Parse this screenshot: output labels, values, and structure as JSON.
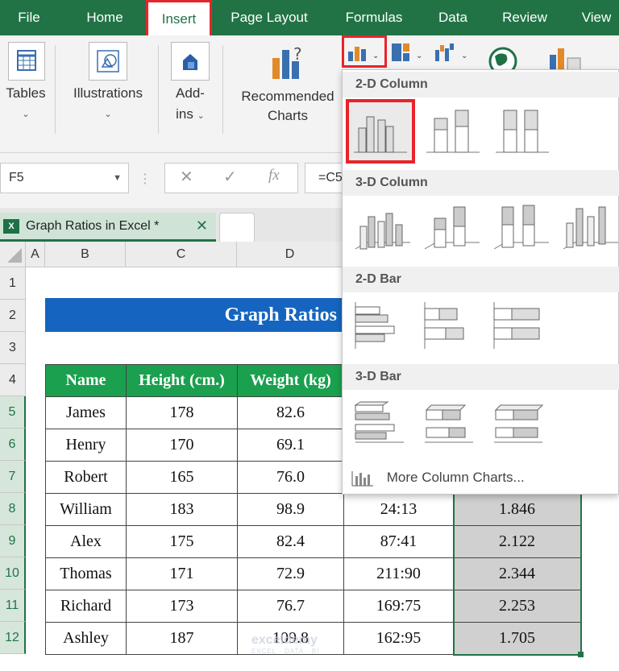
{
  "ribbon": {
    "tabs": [
      "File",
      "Home",
      "Insert",
      "Page Layout",
      "Formulas",
      "Data",
      "Review",
      "View"
    ],
    "groups": {
      "tables": "Tables",
      "illustrations": "Illustrations",
      "addins_line1": "Add-",
      "addins_line2": "ins",
      "recommended_line1": "Recommended",
      "recommended_line2": "Charts"
    }
  },
  "formula_bar": {
    "name_box": "F5",
    "formula": "=C5",
    "fx": "fx"
  },
  "workbook_tab": "Graph Ratios in Excel *",
  "columns": [
    "A",
    "B",
    "C",
    "D"
  ],
  "rows": [
    "1",
    "2",
    "3",
    "4",
    "5",
    "6",
    "7",
    "8",
    "9",
    "10",
    "11",
    "12"
  ],
  "sheet": {
    "title": "Graph Ratios",
    "headers": [
      "Name",
      "Height (cm.)",
      "Weight (kg)"
    ],
    "data": [
      {
        "name": "James",
        "height": "178",
        "weight": "82.6",
        "ratio": "",
        "value": ""
      },
      {
        "name": "Henry",
        "height": "170",
        "weight": "69.1",
        "ratio": "",
        "value": ""
      },
      {
        "name": "Robert",
        "height": "165",
        "weight": "76.0",
        "ratio": "",
        "value": ""
      },
      {
        "name": "William",
        "height": "183",
        "weight": "98.9",
        "ratio": "24:13",
        "value": "1.846"
      },
      {
        "name": "Alex",
        "height": "175",
        "weight": "82.4",
        "ratio": "87:41",
        "value": "2.122"
      },
      {
        "name": "Thomas",
        "height": "171",
        "weight": "72.9",
        "ratio": "211:90",
        "value": "2.344"
      },
      {
        "name": "Richard",
        "height": "173",
        "weight": "76.7",
        "ratio": "169:75",
        "value": "2.253"
      },
      {
        "name": "Ashley",
        "height": "187",
        "weight": "109.8",
        "ratio": "162:95",
        "value": "1.705"
      }
    ]
  },
  "dropdown": {
    "sections": [
      "2-D Column",
      "3-D Column",
      "2-D Bar",
      "3-D Bar"
    ],
    "more": "More Column Charts..."
  },
  "watermark": {
    "name": "exceldemy",
    "tag": "EXCEL · DATA · BI"
  },
  "colors": {
    "excel_green": "#217346",
    "header_green": "#1aa04e",
    "title_blue": "#1565c0",
    "highlight_red": "#e8242b"
  }
}
